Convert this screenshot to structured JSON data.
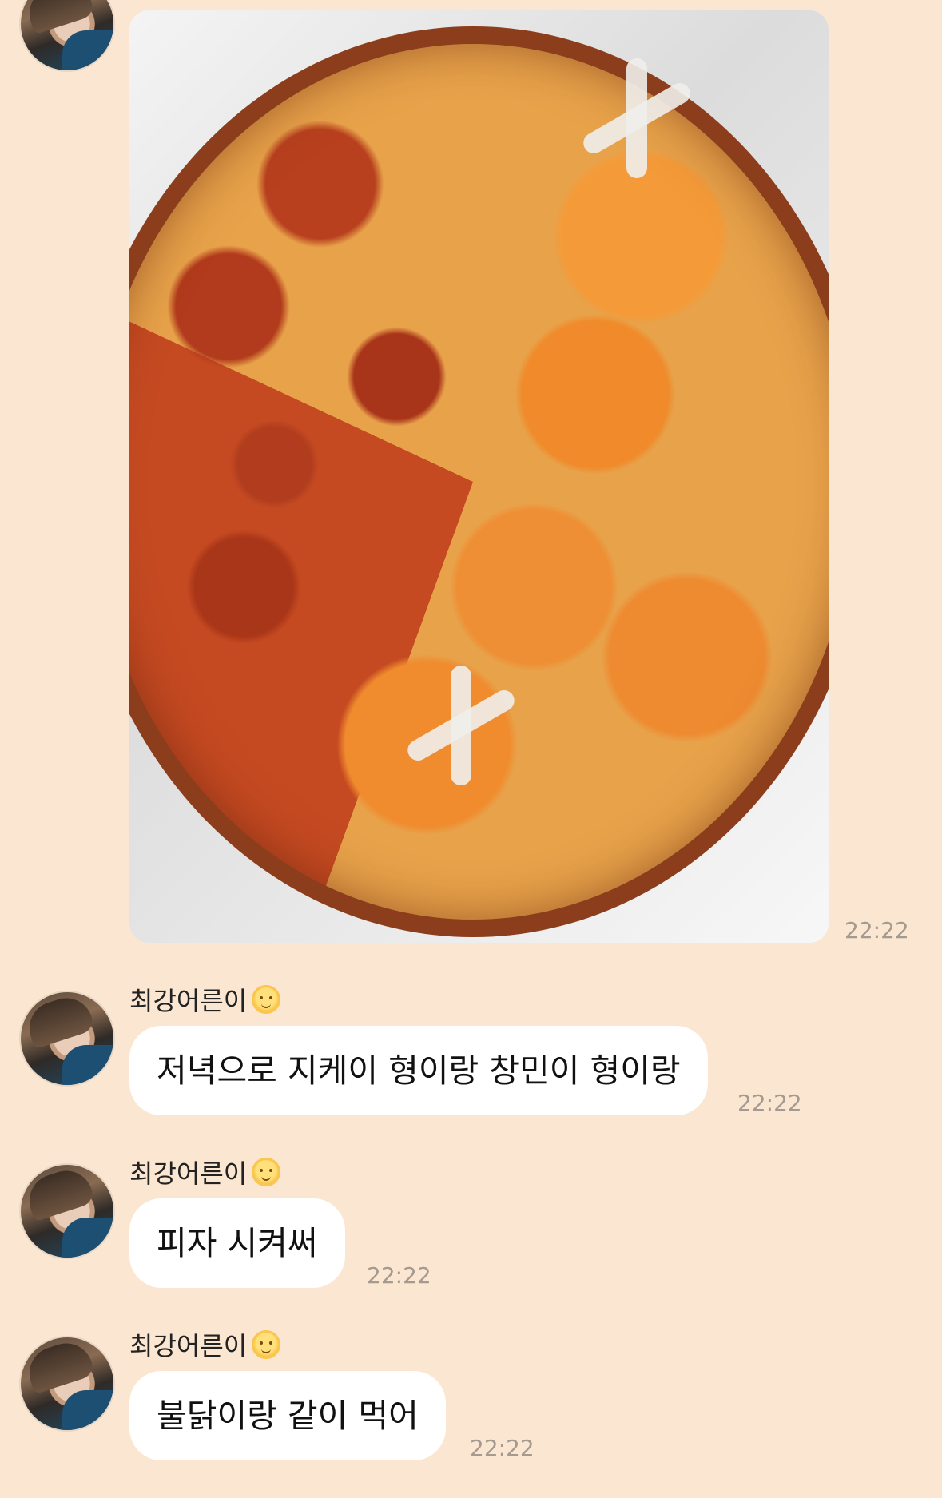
{
  "photo_message": {
    "time": "22:22"
  },
  "messages": [
    {
      "sender": "최강어른이",
      "text": "저녁으로 지케이 형이랑 창민이 형이랑",
      "time": "22:22"
    },
    {
      "sender": "최강어른이",
      "text": "피자 시켜써",
      "time": "22:22"
    },
    {
      "sender": "최강어른이",
      "text": "불닭이랑 같이 먹어",
      "time": "22:22"
    }
  ],
  "icons": {
    "sender_badge": "sun-emoji-icon"
  },
  "colors": {
    "background": "#fbe6d1",
    "bubble": "#ffffff",
    "timestamp": "#a59a8f"
  }
}
